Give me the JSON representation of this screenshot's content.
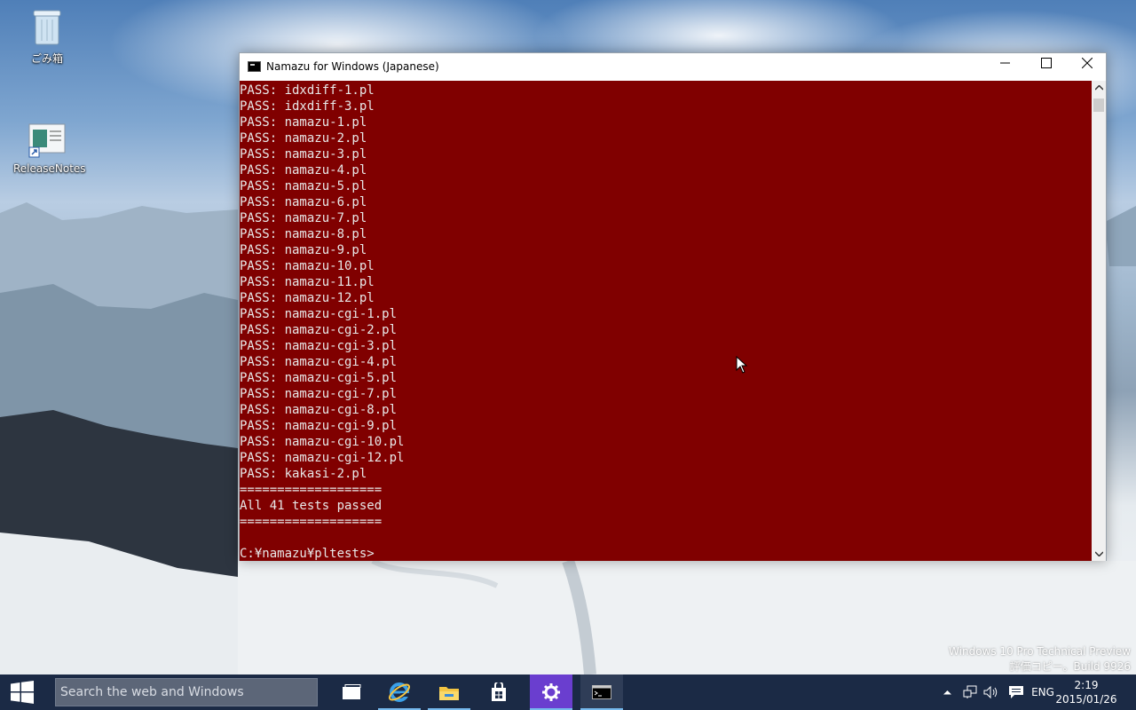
{
  "desktop": {
    "icons": [
      {
        "label": "ごみ箱",
        "icon": "recycle-bin-icon"
      },
      {
        "label": "ReleaseNotes",
        "icon": "document-shortcut-icon"
      }
    ],
    "watermark": {
      "line1": "Windows 10 Pro Technical Preview",
      "line2": "評価コピー。Build 9926"
    }
  },
  "window": {
    "title": "Namazu for Windows (Japanese)",
    "icon": "console-icon",
    "controls": {
      "minimize": "minimize-icon",
      "maximize": "maximize-icon",
      "close": "close-icon"
    },
    "console_bg": "#800000",
    "console_lines": [
      "PASS: idxdiff-1.pl",
      "PASS: idxdiff-3.pl",
      "PASS: namazu-1.pl",
      "PASS: namazu-2.pl",
      "PASS: namazu-3.pl",
      "PASS: namazu-4.pl",
      "PASS: namazu-5.pl",
      "PASS: namazu-6.pl",
      "PASS: namazu-7.pl",
      "PASS: namazu-8.pl",
      "PASS: namazu-9.pl",
      "PASS: namazu-10.pl",
      "PASS: namazu-11.pl",
      "PASS: namazu-12.pl",
      "PASS: namazu-cgi-1.pl",
      "PASS: namazu-cgi-2.pl",
      "PASS: namazu-cgi-3.pl",
      "PASS: namazu-cgi-4.pl",
      "PASS: namazu-cgi-5.pl",
      "PASS: namazu-cgi-7.pl",
      "PASS: namazu-cgi-8.pl",
      "PASS: namazu-cgi-9.pl",
      "PASS: namazu-cgi-10.pl",
      "PASS: namazu-cgi-12.pl",
      "PASS: kakasi-2.pl",
      "===================",
      "All 41 tests passed",
      "===================",
      "",
      "C:¥namazu¥pltests>"
    ]
  },
  "taskbar": {
    "search_placeholder": "Search the web and Windows",
    "apps": [
      {
        "name": "task-view",
        "icon": "task-view-icon"
      },
      {
        "name": "internet-explorer",
        "icon": "internet-explorer-icon"
      },
      {
        "name": "file-explorer",
        "icon": "file-explorer-icon"
      },
      {
        "name": "store",
        "icon": "store-icon"
      },
      {
        "name": "settings",
        "icon": "gear-icon"
      },
      {
        "name": "command-prompt",
        "icon": "console-icon"
      }
    ],
    "tray": {
      "language": "ENG",
      "time": "2:19",
      "date": "2015/01/26"
    },
    "color": "#1b2a45",
    "accent": "#76b9ed"
  }
}
